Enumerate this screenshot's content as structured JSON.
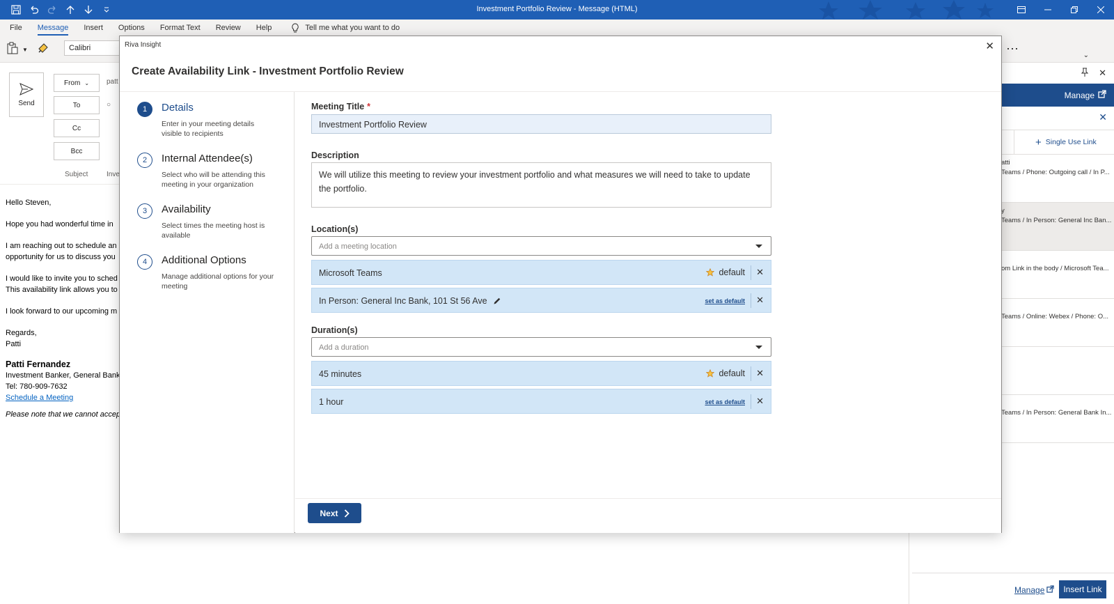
{
  "window": {
    "title": "Investment Portfolio Review  -  Message (HTML)"
  },
  "ribbon": {
    "tabs": [
      "File",
      "Message",
      "Insert",
      "Options",
      "Format Text",
      "Review",
      "Help"
    ],
    "active_tab": "Message",
    "tell_me": "Tell me what you want to do",
    "font_name": "Calibri"
  },
  "compose": {
    "send_label": "Send",
    "from_label": "From",
    "to_label": "To",
    "cc_label": "Cc",
    "bcc_label": "Bcc",
    "subject_label": "Subject",
    "from_value": "patt",
    "subject_value": "Inve",
    "body": {
      "greeting": "Hello Steven,",
      "line1": "Hope you had wonderful time in",
      "line2a": "I am reaching out to schedule an",
      "line2b": "opportunity for us to discuss you",
      "line3a": "I would like to invite you to sched",
      "line3b": "This availability link allows you to",
      "line4": "I look forward to our upcoming m",
      "closing": "Regards,",
      "closing_name": "Patti",
      "sig_name": "Patti Fernandez",
      "sig_title": "Investment Banker, General Bank",
      "sig_tel": "Tel: 780-909-7632",
      "sig_link": "Schedule a Meeting",
      "note": "Please note that we cannot accep"
    }
  },
  "pane": {
    "manage_label": "Manage",
    "single_use_label": "Single Use Link",
    "items": [
      {
        "line1": "atti",
        "line2": "Teams / Phone: Outgoing call / In P..."
      },
      {
        "line1": "y",
        "line2": "Teams / In Person: General Inc Ban..."
      },
      {
        "line1": "",
        "line2": "om Link in the body / Microsoft Tea..."
      },
      {
        "line1": "",
        "line2": "Teams / Online: Webex / Phone: O..."
      },
      {
        "line1": "",
        "line2": ""
      },
      {
        "line1": "",
        "line2": "Teams / In Person: General Bank In..."
      }
    ],
    "footer_manage": "Manage",
    "insert_link": "Insert Link"
  },
  "modal": {
    "app_name": "Riva Insight",
    "title": "Create Availability Link - Investment Portfolio Review",
    "steps": [
      {
        "num": "1",
        "title": "Details",
        "desc": "Enter in your meeting details visible to recipients"
      },
      {
        "num": "2",
        "title": "Internal Attendee(s)",
        "desc": "Select who will be attending this meeting in your organization"
      },
      {
        "num": "3",
        "title": "Availability",
        "desc": "Select times the meeting host is available"
      },
      {
        "num": "4",
        "title": "Additional Options",
        "desc": "Manage additional options for your meeting"
      }
    ],
    "form": {
      "meeting_title_label": "Meeting Title",
      "required_mark": "*",
      "meeting_title_value": "Investment Portfolio Review",
      "description_label": "Description",
      "description_value": "We will utilize this meeting to review your investment portfolio and what measures we will need to take to update the portfolio.",
      "locations_label": "Location(s)",
      "location_placeholder": "Add a meeting location",
      "locations": [
        {
          "name": "Microsoft Teams",
          "default_label": "default"
        },
        {
          "name": "In Person: General Inc Bank, 101 St 56 Ave",
          "set_default_label": "set as default"
        }
      ],
      "durations_label": "Duration(s)",
      "duration_placeholder": "Add a duration",
      "durations": [
        {
          "name": "45 minutes",
          "default_label": "default"
        },
        {
          "name": "1 hour",
          "set_default_label": "set as default"
        }
      ]
    },
    "next_label": "Next"
  },
  "colors": {
    "titlebar": "#1f5fb5",
    "accent": "#1e4d8c",
    "chip_bg": "#d2e6f7",
    "star": "#c8862a"
  }
}
